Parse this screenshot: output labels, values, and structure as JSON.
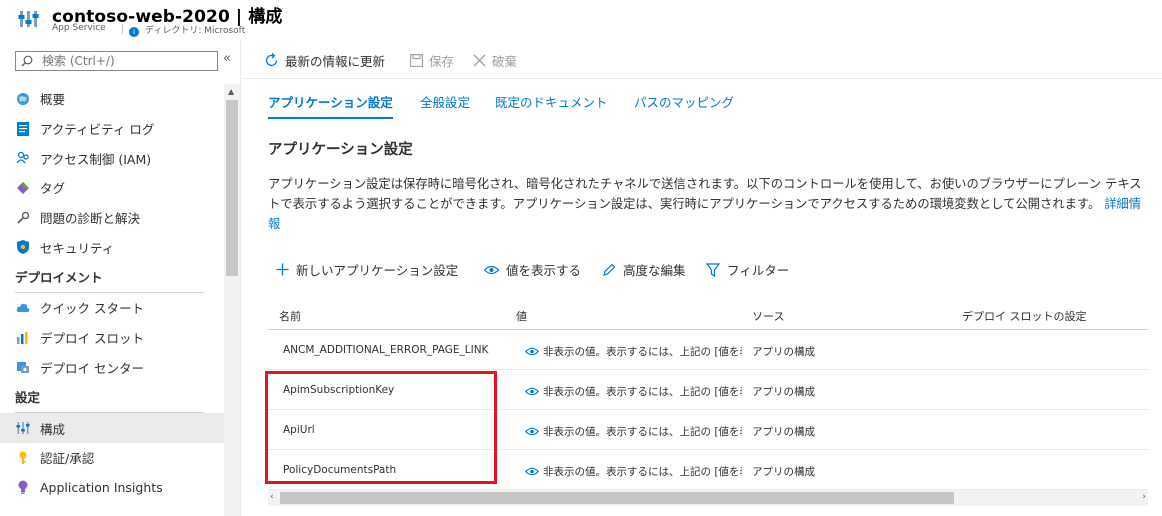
{
  "header": {
    "title": "contoso-web-2020 | 構成",
    "subtitle": "App Service",
    "directory": "ディレクトリ: Microsoft"
  },
  "sidebar": {
    "search_placeholder": "検索 (Ctrl+/)",
    "collapse": "«",
    "items": [
      {
        "label": "概要",
        "icon": "globe-icon"
      },
      {
        "label": "アクティビティ ログ",
        "icon": "log-icon"
      },
      {
        "label": "アクセス制御 (IAM)",
        "icon": "people-icon"
      },
      {
        "label": "タグ",
        "icon": "tag-icon"
      },
      {
        "label": "問題の診断と解決",
        "icon": "wrench-icon"
      },
      {
        "label": "セキュリティ",
        "icon": "shield-icon"
      }
    ],
    "section_deploy": "デプロイメント",
    "deploy_items": [
      {
        "label": "クイック スタート",
        "icon": "cloud-icon"
      },
      {
        "label": "デプロイ スロット",
        "icon": "slots-icon"
      },
      {
        "label": "デプロイ センター",
        "icon": "deploy-center-icon"
      }
    ],
    "section_settings": "設定",
    "settings_items": [
      {
        "label": "構成",
        "icon": "config-icon",
        "active": true
      },
      {
        "label": "認証/承認",
        "icon": "key-icon"
      },
      {
        "label": "Application Insights",
        "icon": "bulb-icon"
      }
    ]
  },
  "commands": {
    "refresh": "最新の情報に更新",
    "save": "保存",
    "discard": "破棄"
  },
  "tabs": [
    "アプリケーション設定",
    "全般設定",
    "既定のドキュメント",
    "パスのマッピング"
  ],
  "section_title": "アプリケーション設定",
  "description": "アプリケーション設定は保存時に暗号化され、暗号化されたチャネルで送信されます。以下のコントロールを使用して、お使いのブラウザーにプレーン テキストで表示するよう選択することができます。アプリケーション設定は、実行時にアプリケーションでアクセスするための環境変数として公開されます。",
  "more_info": "詳細情報",
  "toolbar": {
    "new_setting": "新しいアプリケーション設定",
    "show_values": "値を表示する",
    "advanced_edit": "高度な編集",
    "filter": "フィルター"
  },
  "grid": {
    "headers": [
      "名前",
      "値",
      "ソース",
      "デプロイ スロットの設定"
    ],
    "rows": [
      {
        "name": "ANCM_ADDITIONAL_ERROR_PAGE_LINK",
        "value": "非表示の値。表示するには、上記の [値を表示する] をクリックしてください",
        "source": "アプリの構成"
      },
      {
        "name": "ApimSubscriptionKey",
        "value": "非表示の値。表示するには、上記の [値を表示する] をクリックしてください",
        "source": "アプリの構成"
      },
      {
        "name": "ApiUrl",
        "value": "非表示の値。表示するには、上記の [値を表示する] をクリックしてください",
        "source": "アプリの構成"
      },
      {
        "name": "PolicyDocumentsPath",
        "value": "非表示の値。表示するには、上記の [値を表示する] をクリックしてください",
        "source": "アプリの構成"
      }
    ]
  },
  "colors": {
    "accent": "#0078d4",
    "highlight": "#e81123"
  }
}
